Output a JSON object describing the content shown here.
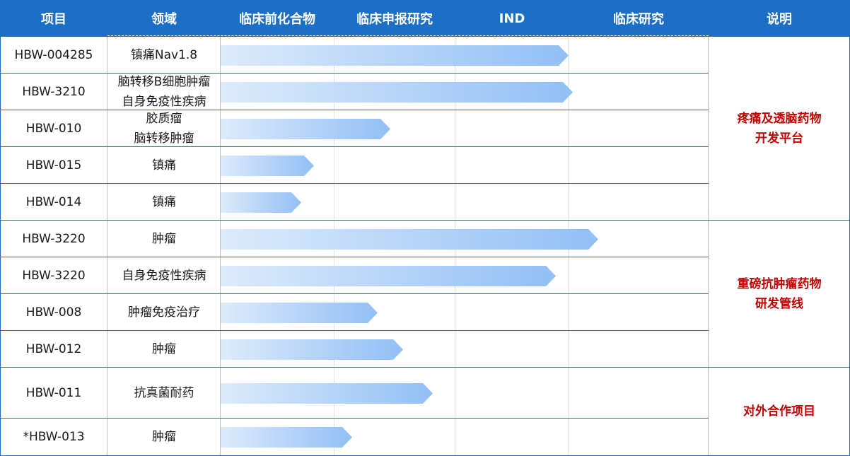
{
  "headers": [
    "项目",
    "领域",
    "临床前化合物",
    "临床申报研究",
    "IND",
    "临床研究",
    "说明"
  ],
  "stages": [
    "临床前化合物",
    "临床申报研究",
    "IND",
    "临床研究"
  ],
  "colors": {
    "header_bg": "#1c6fc4",
    "note_text": "#c00000",
    "bar_start": "#ddebfb",
    "bar_end": "#92bff5"
  },
  "rows": [
    {
      "project": "HBW-004285",
      "area": [
        "镇痛Nav1.8"
      ],
      "progress_pct": 82
    },
    {
      "project": "HBW-3210",
      "area": [
        "脑转移B细胞肿瘤",
        "自身免疫性疾病"
      ],
      "progress_pct": 83
    },
    {
      "project": "HBW-010",
      "area": [
        "胶质瘤",
        "脑转移肿瘤"
      ],
      "progress_pct": 40
    },
    {
      "project": "HBW-015",
      "area": [
        "镇痛"
      ],
      "progress_pct": 22
    },
    {
      "project": "HBW-014",
      "area": [
        "镇痛"
      ],
      "progress_pct": 19
    },
    {
      "project": "HBW-3220",
      "area": [
        "肿瘤"
      ],
      "progress_pct": 89
    },
    {
      "project": "HBW-3220",
      "area": [
        "自身免疫性疾病"
      ],
      "progress_pct": 79
    },
    {
      "project": "HBW-008",
      "area": [
        "肿瘤免疫治疗"
      ],
      "progress_pct": 37
    },
    {
      "project": "HBW-012",
      "area": [
        "肿瘤"
      ],
      "progress_pct": 43
    },
    {
      "project": "HBW-011",
      "area": [
        "抗真菌耐药"
      ],
      "progress_pct": 50
    },
    {
      "project": "*HBW-013",
      "area": [
        "肿瘤"
      ],
      "progress_pct": 31
    }
  ],
  "notes": [
    {
      "lines": [
        "疼痛及透脑药物",
        "开发平台"
      ]
    },
    {
      "lines": [
        "重磅抗肿瘤药物",
        "研发管线"
      ]
    },
    {
      "lines": [
        "对外合作项目"
      ]
    }
  ]
}
